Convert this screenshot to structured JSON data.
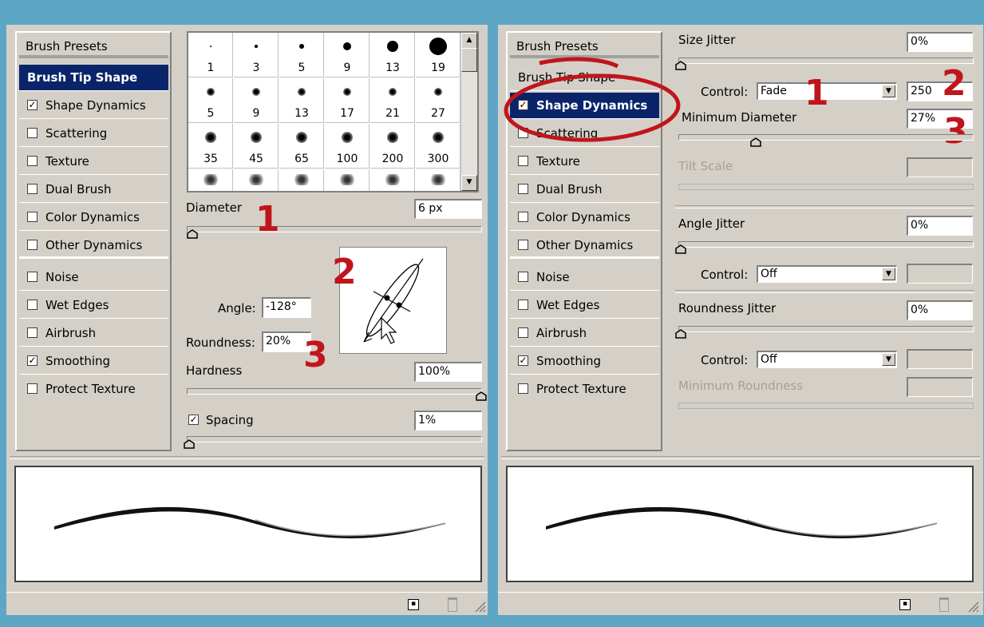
{
  "brush_list": {
    "header": "Brush Presets",
    "items": [
      {
        "label": "Brush Tip Shape",
        "checkbox": false
      },
      {
        "label": "Shape Dynamics",
        "checkbox": true,
        "checked": true
      },
      {
        "label": "Scattering",
        "checkbox": true,
        "checked": false
      },
      {
        "label": "Texture",
        "checkbox": true,
        "checked": false
      },
      {
        "label": "Dual Brush",
        "checkbox": true,
        "checked": false
      },
      {
        "label": "Color Dynamics",
        "checkbox": true,
        "checked": false
      },
      {
        "label": "Other Dynamics",
        "checkbox": true,
        "checked": false
      },
      {
        "label": "Noise",
        "checkbox": true,
        "checked": false
      },
      {
        "label": "Wet Edges",
        "checkbox": true,
        "checked": false
      },
      {
        "label": "Airbrush",
        "checkbox": true,
        "checked": false
      },
      {
        "label": "Smoothing",
        "checkbox": true,
        "checked": true
      },
      {
        "label": "Protect Texture",
        "checkbox": true,
        "checked": false
      }
    ]
  },
  "left_panel": {
    "selected_item": "Brush Tip Shape",
    "brush_sizes": [
      "1",
      "3",
      "5",
      "9",
      "13",
      "19",
      "5",
      "9",
      "13",
      "17",
      "21",
      "27",
      "35",
      "45",
      "65",
      "100",
      "200",
      "300"
    ],
    "diameter_label": "Diameter",
    "diameter_value": "6 px",
    "angle_label": "Angle:",
    "angle_value": "-128°",
    "roundness_label": "Roundness:",
    "roundness_value": "20%",
    "hardness_label": "Hardness",
    "hardness_value": "100%",
    "spacing_label": "Spacing",
    "spacing_checked": true,
    "spacing_value": "1%",
    "annotations": [
      "1",
      "2",
      "3"
    ]
  },
  "right_panel": {
    "selected_item": "Shape Dynamics",
    "size_jitter_label": "Size Jitter",
    "size_jitter_value": "0%",
    "control_label": "Control:",
    "control_value": "Fade",
    "fade_steps": "250",
    "min_diameter_label": "Minimum Diameter",
    "min_diameter_value": "27%",
    "tilt_scale_label": "Tilt Scale",
    "angle_jitter_label": "Angle Jitter",
    "angle_jitter_value": "0%",
    "angle_control_label": "Control:",
    "angle_control_value": "Off",
    "roundness_jitter_label": "Roundness Jitter",
    "roundness_jitter_value": "0%",
    "roundness_control_label": "Control:",
    "roundness_control_value": "Off",
    "min_roundness_label": "Minimum Roundness",
    "annotations": [
      "1",
      "2",
      "3"
    ]
  },
  "colors": {
    "background": "#5ea6c5",
    "panel": "#d4d0c8",
    "selection": "#0a246a",
    "annotation": "#c0151b"
  }
}
